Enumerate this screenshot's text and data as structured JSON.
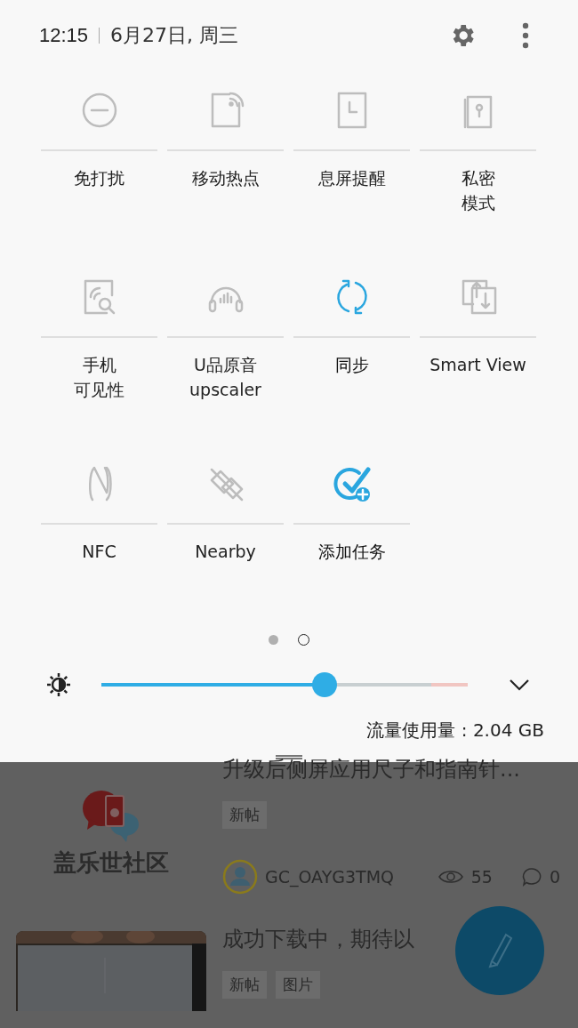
{
  "status": {
    "time": "12:15",
    "date": "6月27日, 周三"
  },
  "tiles": [
    {
      "kind": "dnd",
      "label": [
        "免打扰"
      ],
      "on": false
    },
    {
      "kind": "hotspot",
      "label": [
        "移动热点"
      ],
      "on": false
    },
    {
      "kind": "aod",
      "label": [
        "息屏提醒"
      ],
      "on": false
    },
    {
      "kind": "secure",
      "label": [
        "私密",
        "模式"
      ],
      "on": false
    },
    {
      "kind": "visibility",
      "label": [
        "手机",
        "可见性"
      ],
      "on": false
    },
    {
      "kind": "upscaler",
      "label": [
        "U品原音",
        "upscaler"
      ],
      "on": false
    },
    {
      "kind": "sync",
      "label": [
        "同步"
      ],
      "on": true
    },
    {
      "kind": "smartview",
      "label": [
        "Smart View"
      ],
      "on": false
    },
    {
      "kind": "nfc",
      "label": [
        "NFC"
      ],
      "on": false
    },
    {
      "kind": "nearby",
      "label": [
        "Nearby"
      ],
      "on": false
    },
    {
      "kind": "task",
      "label": [
        "添加任务"
      ],
      "on": true
    }
  ],
  "pages": [
    {
      "selected": false
    },
    {
      "selected": true
    }
  ],
  "brightness": {
    "level": 0.61
  },
  "data_usage": "流量使用量 : 2.04 GB",
  "feed": {
    "logo_text": "盖乐世社区",
    "posts": [
      {
        "title": "升级后侧屏应用尺子和指南针...",
        "tags": [
          "新帖"
        ],
        "author": "GC_OAYG3TMQ",
        "views": "55",
        "comments": "0"
      },
      {
        "title": "成功下载中，期待以",
        "tags": [
          "新帖",
          "图片"
        ]
      }
    ]
  }
}
